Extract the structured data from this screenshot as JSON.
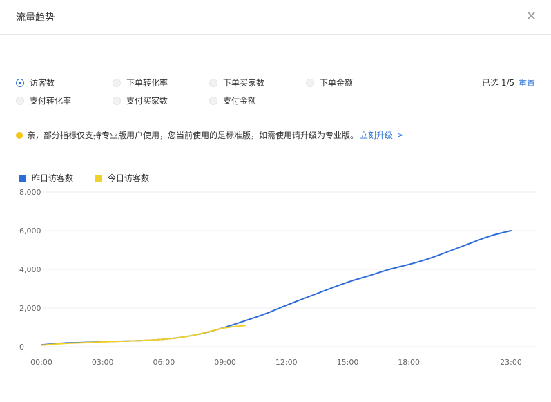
{
  "dialog": {
    "title": "流量趋势",
    "close_icon": "close-icon"
  },
  "metrics": [
    {
      "label": "访客数",
      "checked": true
    },
    {
      "label": "下单转化率",
      "checked": false
    },
    {
      "label": "下单买家数",
      "checked": false
    },
    {
      "label": "下单金额",
      "checked": false
    },
    {
      "label": "支付转化率",
      "checked": false
    },
    {
      "label": "支付买家数",
      "checked": false
    },
    {
      "label": "支付金额",
      "checked": false
    }
  ],
  "selection": {
    "count_text": "已选 1/5",
    "reset_label": "重置"
  },
  "notice": {
    "text": "亲，部分指标仅支持专业版用户使用，您当前使用的是标准版，如需使用请升级为专业版。",
    "link_label": "立刻升级",
    "link_arrow": ">",
    "icon": "info-dot-icon"
  },
  "colors": {
    "accent": "#2e74d6",
    "yesterday": "#2e6bd9",
    "today": "#f0d02a",
    "notice": "#f5c518"
  },
  "chart_data": {
    "type": "line",
    "x_tick_labels": [
      "00:00",
      "03:00",
      "06:00",
      "09:00",
      "12:00",
      "15:00",
      "18:00",
      "23:00"
    ],
    "y_tick_labels": [
      "0",
      "2,000",
      "4,000",
      "6,000",
      "8,000"
    ],
    "ylim": [
      0,
      8000
    ],
    "grid": true,
    "legend_position": "top-left",
    "series": [
      {
        "name": "昨日访客数",
        "color": "#2e6bd9",
        "x": [
          "00:00",
          "01:00",
          "02:00",
          "03:00",
          "04:00",
          "05:00",
          "06:00",
          "07:00",
          "08:00",
          "09:00",
          "10:00",
          "11:00",
          "12:00",
          "13:00",
          "14:00",
          "15:00",
          "16:00",
          "17:00",
          "18:00",
          "19:00",
          "20:00",
          "21:00",
          "22:00",
          "23:00"
        ],
        "values": [
          100,
          200,
          220,
          260,
          290,
          320,
          380,
          500,
          700,
          1000,
          1350,
          1700,
          2150,
          2550,
          2950,
          3350,
          3650,
          4000,
          4250,
          4550,
          4950,
          5350,
          5750,
          6000
        ]
      },
      {
        "name": "今日访客数",
        "color": "#f0d02a",
        "x": [
          "00:00",
          "01:00",
          "02:00",
          "03:00",
          "04:00",
          "05:00",
          "06:00",
          "07:00",
          "08:00",
          "09:00",
          "10:00"
        ],
        "values": [
          80,
          170,
          210,
          250,
          290,
          320,
          380,
          490,
          720,
          1000,
          1100
        ]
      }
    ]
  }
}
